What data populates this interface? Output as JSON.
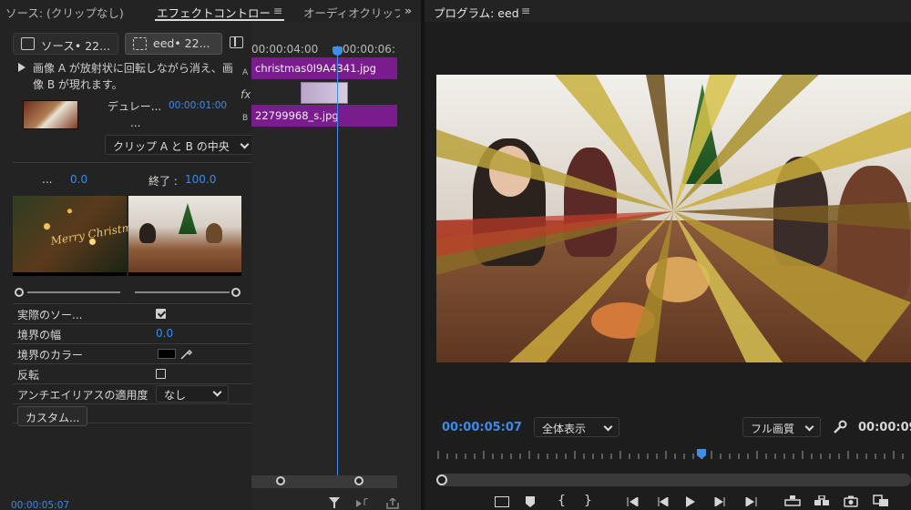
{
  "tabs": {
    "source": "ソース: (クリップなし)",
    "effect_controls": "エフェクトコントロー",
    "audio_clip": "オーディオクリップ",
    "menu_glyph": "≡",
    "overflow": "»"
  },
  "effect_controls": {
    "clip_tab_source": "ソース• 22...",
    "clip_tab_sequence": "eed• 22...",
    "description": "画像 A が放射状に回転しながら消え、画像 B が現れます。",
    "duration_label": "デュレー...",
    "duration_value": "00:00:01:00",
    "ellipsis": "...",
    "alignment_value": "クリップ A と B の中央",
    "start_label": "...",
    "start_value": "0.0",
    "end_label": "終了 :",
    "end_value": "100.0",
    "preview_a_text": "Merry Christmas",
    "properties": [
      {
        "label": "実際のソー...",
        "type": "checkbox",
        "checked": true
      },
      {
        "label": "境界の幅",
        "type": "number",
        "value": "0.0"
      },
      {
        "label": "境界のカラー",
        "type": "color",
        "value": "#000000"
      },
      {
        "label": "反転",
        "type": "checkbox",
        "checked": false
      },
      {
        "label": "アンチエイリアスの適用度",
        "type": "select",
        "value": "なし"
      }
    ],
    "custom_button": "カスタム...",
    "timecode": "00:00:05:07"
  },
  "mini_timeline": {
    "ruler_left": "00:00:04:00",
    "ruler_right": "00:00:06:",
    "track_a_label": "A",
    "track_b_label": "B",
    "fx_label": "fx",
    "clip_a_name": "christmas0I9A4341.jpg",
    "clip_b_name": "22799968_s.jpg"
  },
  "program_monitor": {
    "title": "プログラム: eed",
    "menu_glyph": "≡",
    "current_timecode": "00:00:05:07",
    "zoom_value": "全体表示",
    "quality_value": "フル画質",
    "duration_timecode": "00:00:09"
  },
  "colors": {
    "accent_blue": "#3a8be8",
    "clip_purple": "#7a1b8e",
    "panel_bg": "#232323"
  }
}
